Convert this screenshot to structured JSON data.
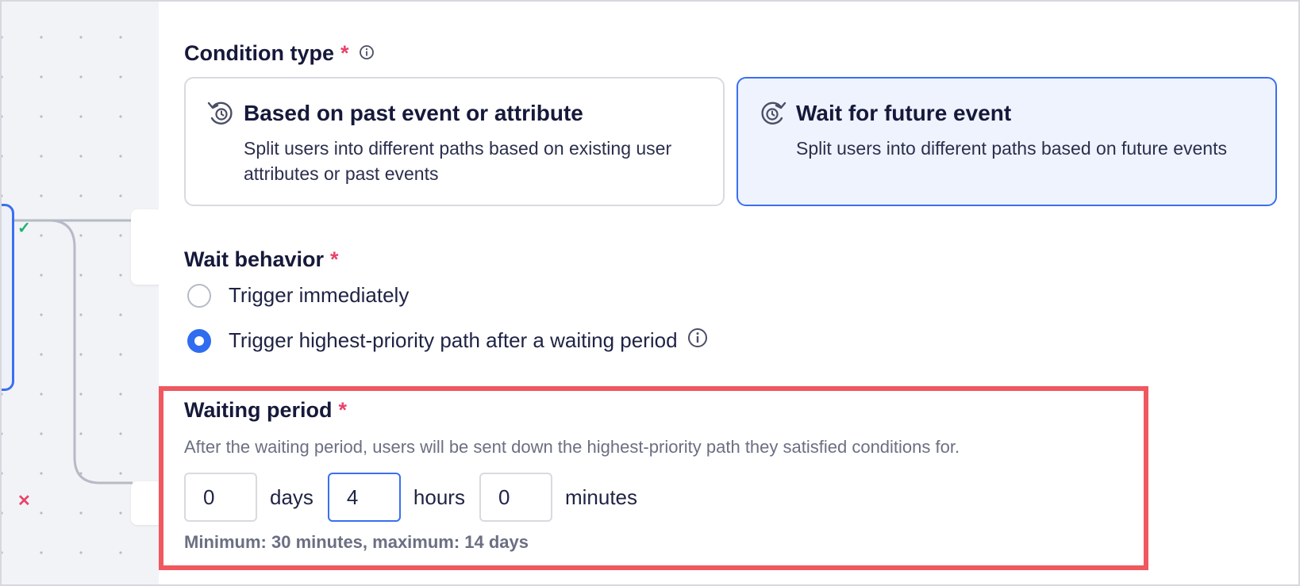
{
  "condition_type": {
    "label": "Condition type",
    "required_mark": "*",
    "options": [
      {
        "title": "Based on past event or attribute",
        "description": "Split users into different paths based on existing user attributes or past events",
        "icon": "history-clock-icon",
        "selected": false
      },
      {
        "title": "Wait for future event",
        "description": "Split users into different paths based on future events",
        "icon": "future-clock-icon",
        "selected": true
      }
    ]
  },
  "wait_behavior": {
    "label": "Wait behavior",
    "required_mark": "*",
    "options": [
      {
        "label": "Trigger immediately",
        "selected": false
      },
      {
        "label": "Trigger highest-priority path after a waiting period",
        "selected": true
      }
    ]
  },
  "waiting_period": {
    "label": "Waiting period",
    "required_mark": "*",
    "description": "After the waiting period, users will be sent down the highest-priority path they satisfied conditions for.",
    "days": {
      "value": "0",
      "unit": "days"
    },
    "hours": {
      "value": "4",
      "unit": "hours"
    },
    "minutes": {
      "value": "0",
      "unit": "minutes"
    },
    "hint": "Minimum: 30 minutes, maximum: 14 days"
  },
  "canvas": {
    "branch_marks": [
      "✓",
      "✕"
    ]
  },
  "colors": {
    "accent": "#2f6cf0",
    "required": "#e8436a",
    "highlight": "#f0585f",
    "selected_card_bg": "#eef3fd"
  }
}
